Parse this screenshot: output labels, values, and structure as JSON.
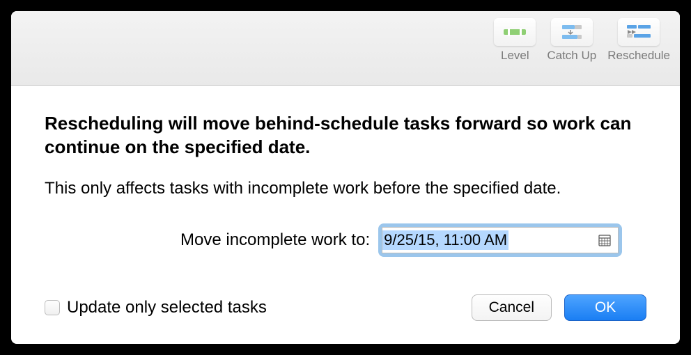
{
  "toolbar": {
    "level_label": "Level",
    "catchup_label": "Catch Up",
    "reschedule_label": "Reschedule"
  },
  "dialog": {
    "heading": "Rescheduling will move behind-schedule tasks forward so work can continue on the specified date.",
    "subtext": "This only affects tasks with incomplete work before the specified date.",
    "field_label": "Move incomplete work to:",
    "date_value": "9/25/15, 11:00 AM",
    "checkbox_label": "Update only selected tasks",
    "cancel_label": "Cancel",
    "ok_label": "OK"
  }
}
